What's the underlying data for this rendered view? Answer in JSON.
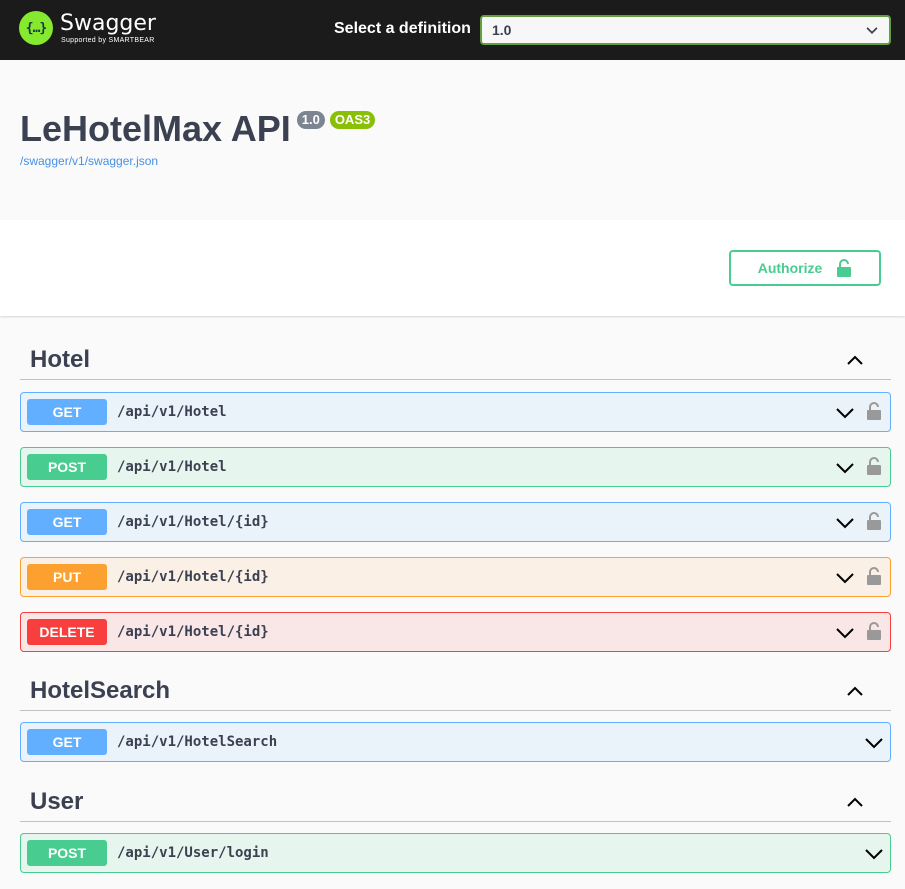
{
  "topbar": {
    "logo_name": "Swagger",
    "logo_sub": "Supported by SMARTBEAR",
    "logo_glyph": "{…}",
    "definition_label": "Select a definition",
    "definition_value": "1.0"
  },
  "info": {
    "title": "LeHotelMax API",
    "version": "1.0",
    "oas": "OAS3",
    "url": "/swagger/v1/swagger.json"
  },
  "authorize": {
    "label": "Authorize",
    "icon": "unlock-icon"
  },
  "sections": [
    {
      "name": "Hotel",
      "ops": [
        {
          "method": "GET",
          "path": "/api/v1/Hotel"
        },
        {
          "method": "POST",
          "path": "/api/v1/Hotel"
        },
        {
          "method": "GET",
          "path": "/api/v1/Hotel/{id}"
        },
        {
          "method": "PUT",
          "path": "/api/v1/Hotel/{id}"
        },
        {
          "method": "DELETE",
          "path": "/api/v1/Hotel/{id}"
        }
      ]
    },
    {
      "name": "HotelSearch",
      "ops": [
        {
          "method": "GET",
          "path": "/api/v1/HotelSearch"
        }
      ]
    },
    {
      "name": "User",
      "ops": [
        {
          "method": "POST",
          "path": "/api/v1/User/login"
        }
      ]
    }
  ],
  "colors": {
    "get": "#61affe",
    "post": "#49cc90",
    "put": "#fca130",
    "delete": "#f93e3e",
    "topbar": "#1b1b1b",
    "logo": "#85ea2d"
  }
}
